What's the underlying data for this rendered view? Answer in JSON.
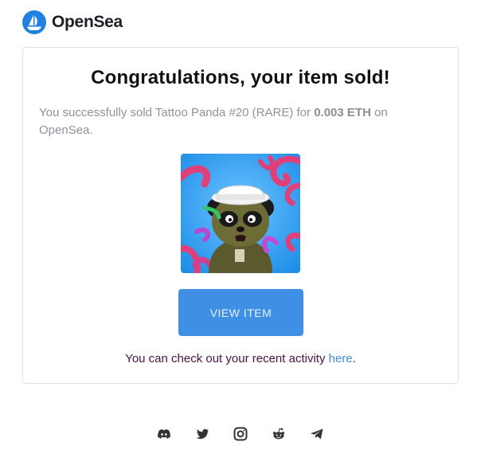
{
  "brand": {
    "name": "OpenSea",
    "color": "#2081e2"
  },
  "email": {
    "headline": "Congratulations, your item sold!",
    "desc_prefix": "You successfully sold Tattoo Panda #20 (RARE) for ",
    "price": "0.003 ETH",
    "desc_suffix": " on OpenSea.",
    "button_label": "VIEW ITEM",
    "activity_text": "You can check out your recent activity ",
    "activity_link": "here",
    "activity_end": "."
  },
  "image": {
    "icon": "tattoo-panda-nft-image"
  },
  "social": [
    "discord-icon",
    "twitter-icon",
    "instagram-icon",
    "reddit-icon",
    "telegram-icon"
  ]
}
